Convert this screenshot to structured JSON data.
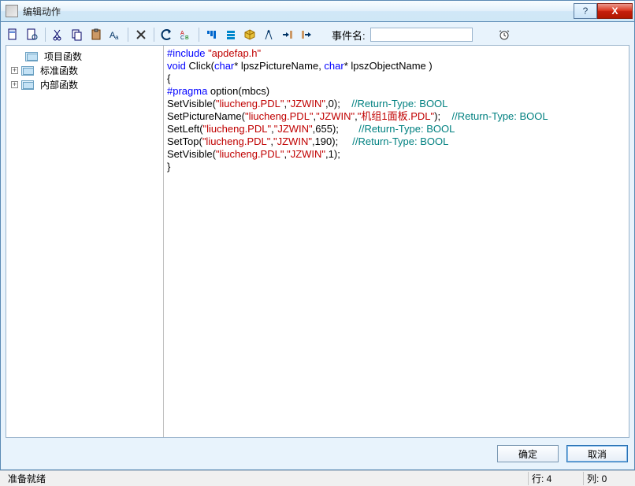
{
  "window": {
    "title": "编辑动作",
    "help": "?",
    "close": "X"
  },
  "toolbar": {
    "event_label": "事件名:",
    "event_value": ""
  },
  "tree": {
    "items": [
      {
        "label": "项目函数",
        "expandable": false
      },
      {
        "label": "标准函数",
        "expandable": true
      },
      {
        "label": "内部函数",
        "expandable": true
      }
    ]
  },
  "code": {
    "l1": {
      "kw1": "#include",
      "str": "\"apdefap.h\""
    },
    "l2": {
      "kw1": "void",
      "fn": " Click(",
      "kw2": "char",
      "mid": "* lpszPictureName, ",
      "kw3": "char",
      "tail": "* lpszObjectName )"
    },
    "l3": "{",
    "l4": {
      "kw1": "#pragma",
      "rest": " option(mbcs)"
    },
    "l5": {
      "call": "SetVisible(",
      "s1": "\"liucheng.PDL\"",
      "c1": ",",
      "s2": "\"JZWIN\"",
      "tail": ",0);",
      "pad": "    ",
      "cmt": "//Return-Type: BOOL"
    },
    "l6": {
      "call": "SetPictureName(",
      "s1": "\"liucheng.PDL\"",
      "c1": ",",
      "s2": "\"JZWIN\"",
      "c2": ",",
      "s3": "\"机组1面板.PDL\"",
      "tail": ");",
      "pad": "    ",
      "cmt": "//Return-Type: BOOL"
    },
    "l7": {
      "call": "SetLeft(",
      "s1": "\"liucheng.PDL\"",
      "c1": ",",
      "s2": "\"JZWIN\"",
      "tail": ",655);",
      "pad": "       ",
      "cmt": "//Return-Type: BOOL"
    },
    "l8": {
      "call": "SetTop(",
      "s1": "\"liucheng.PDL\"",
      "c1": ",",
      "s2": "\"JZWIN\"",
      "tail": ",190);",
      "pad": "     ",
      "cmt": "//Return-Type: BOOL"
    },
    "l9": {
      "call": "SetVisible(",
      "s1": "\"liucheng.PDL\"",
      "c1": ",",
      "s2": "\"JZWIN\"",
      "tail": ",1);"
    },
    "l10": "}"
  },
  "buttons": {
    "ok": "确定",
    "cancel": "取消"
  },
  "status": {
    "ready": "准备就绪",
    "row": "行: 4",
    "col": "列: 0"
  }
}
